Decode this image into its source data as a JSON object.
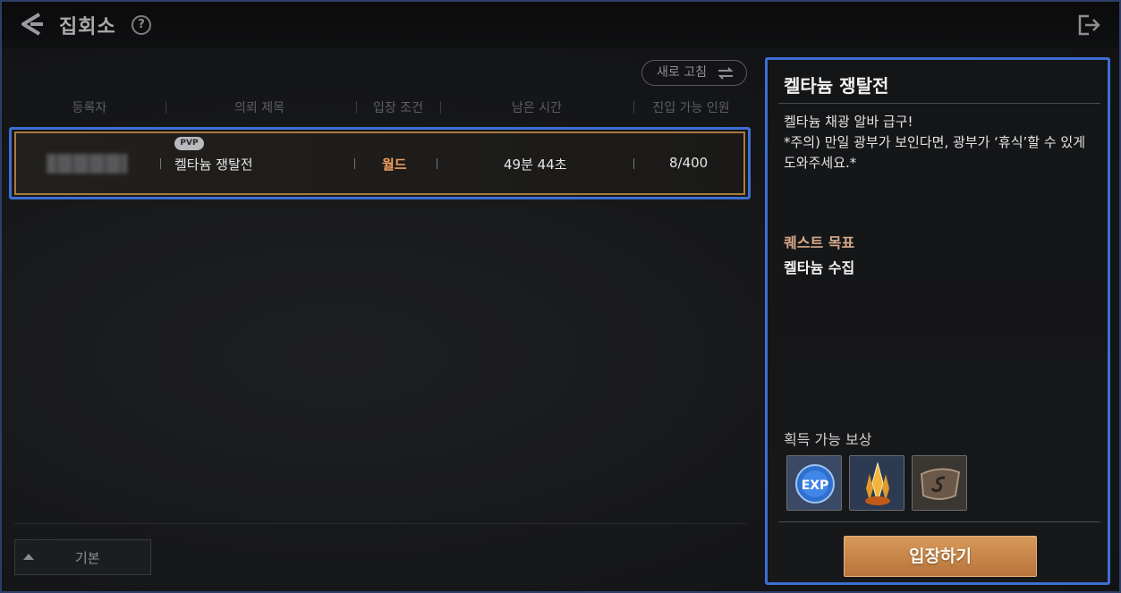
{
  "header": {
    "title": "집회소",
    "help_glyph": "?"
  },
  "list": {
    "refresh_label": "새로 고침",
    "columns": [
      "등록자",
      "의뢰 제목",
      "입장 조건",
      "남은 시간",
      "진입 가능 인원"
    ],
    "rows": [
      {
        "badge": "PVP",
        "title": "켈타늄 쟁탈전",
        "condition": "월드",
        "remaining": "49분 44초",
        "capacity": "8/400"
      }
    ],
    "filter_label": "기본"
  },
  "detail": {
    "title": "켈타늄 쟁탈전",
    "description_line1": "켈타늄 채광 알바 급구!",
    "description_line2": "*주의) 만일 광부가 보인다면, 광부가 ‘휴식’할 수 있게 도와주세요.*",
    "quest_goal_label": "퀘스트 목표",
    "quest_goal": "켈타늄 수집",
    "reward_label": "획득 가능 보상",
    "rewards": [
      "exp-icon",
      "crystal-icon",
      "scroll-icon"
    ],
    "enter_label": "입장하기"
  },
  "colors": {
    "accent_orange": "#c98548",
    "highlight_blue": "#3d6fd1",
    "condition_text": "#f0a060"
  }
}
